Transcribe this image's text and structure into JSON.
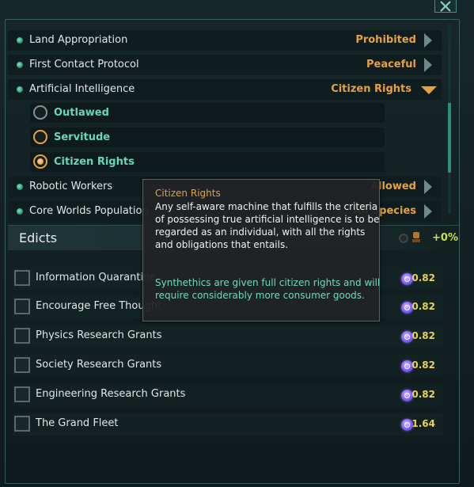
{
  "policies": [
    {
      "label": "Land Appropriation",
      "value": "Prohibited"
    },
    {
      "label": "First Contact Protocol",
      "value": "Peaceful"
    },
    {
      "label": "Artificial Intelligence",
      "value": "Citizen Rights"
    },
    {
      "label": "Robotic Workers",
      "value": "Allowed"
    },
    {
      "label": "Core Worlds Population",
      "value": "All Species"
    }
  ],
  "ai_options": [
    "Outlawed",
    "Servitude",
    "Citizen Rights"
  ],
  "ai_selected": "Citizen Rights",
  "tooltip": {
    "title": "Citizen Rights",
    "body": "Any self-aware machine that fulfills the criteria of possessing true artificial intelligence is to be regarded as an individual, with all the rights and obligations that entails.",
    "note": "Synthethics are given full citizen rights and will require considerably more consumer goods."
  },
  "edicts": {
    "title": "Edicts",
    "modifier": "+0%",
    "items": [
      {
        "label": "Information Quarantine",
        "cost": "0.82"
      },
      {
        "label": "Encourage Free Thought",
        "cost": "0.82"
      },
      {
        "label": "Physics Research Grants",
        "cost": "0.82"
      },
      {
        "label": "Society Research Grants",
        "cost": "0.82"
      },
      {
        "label": "Engineering Research Grants",
        "cost": "0.82"
      },
      {
        "label": "The Grand Fleet",
        "cost": "1.64"
      }
    ]
  },
  "colors": {
    "accent_orange": "#e6a23e",
    "accent_teal": "#67d8b7",
    "cost_yellow": "#e5d35a",
    "modifier_green": "#c8e24a"
  },
  "icons": {
    "close": "close-icon",
    "policy_bullet": "bullet-icon",
    "expand": "arrow-right-icon",
    "collapse": "arrow-down-icon",
    "influence": "influence-icon"
  }
}
